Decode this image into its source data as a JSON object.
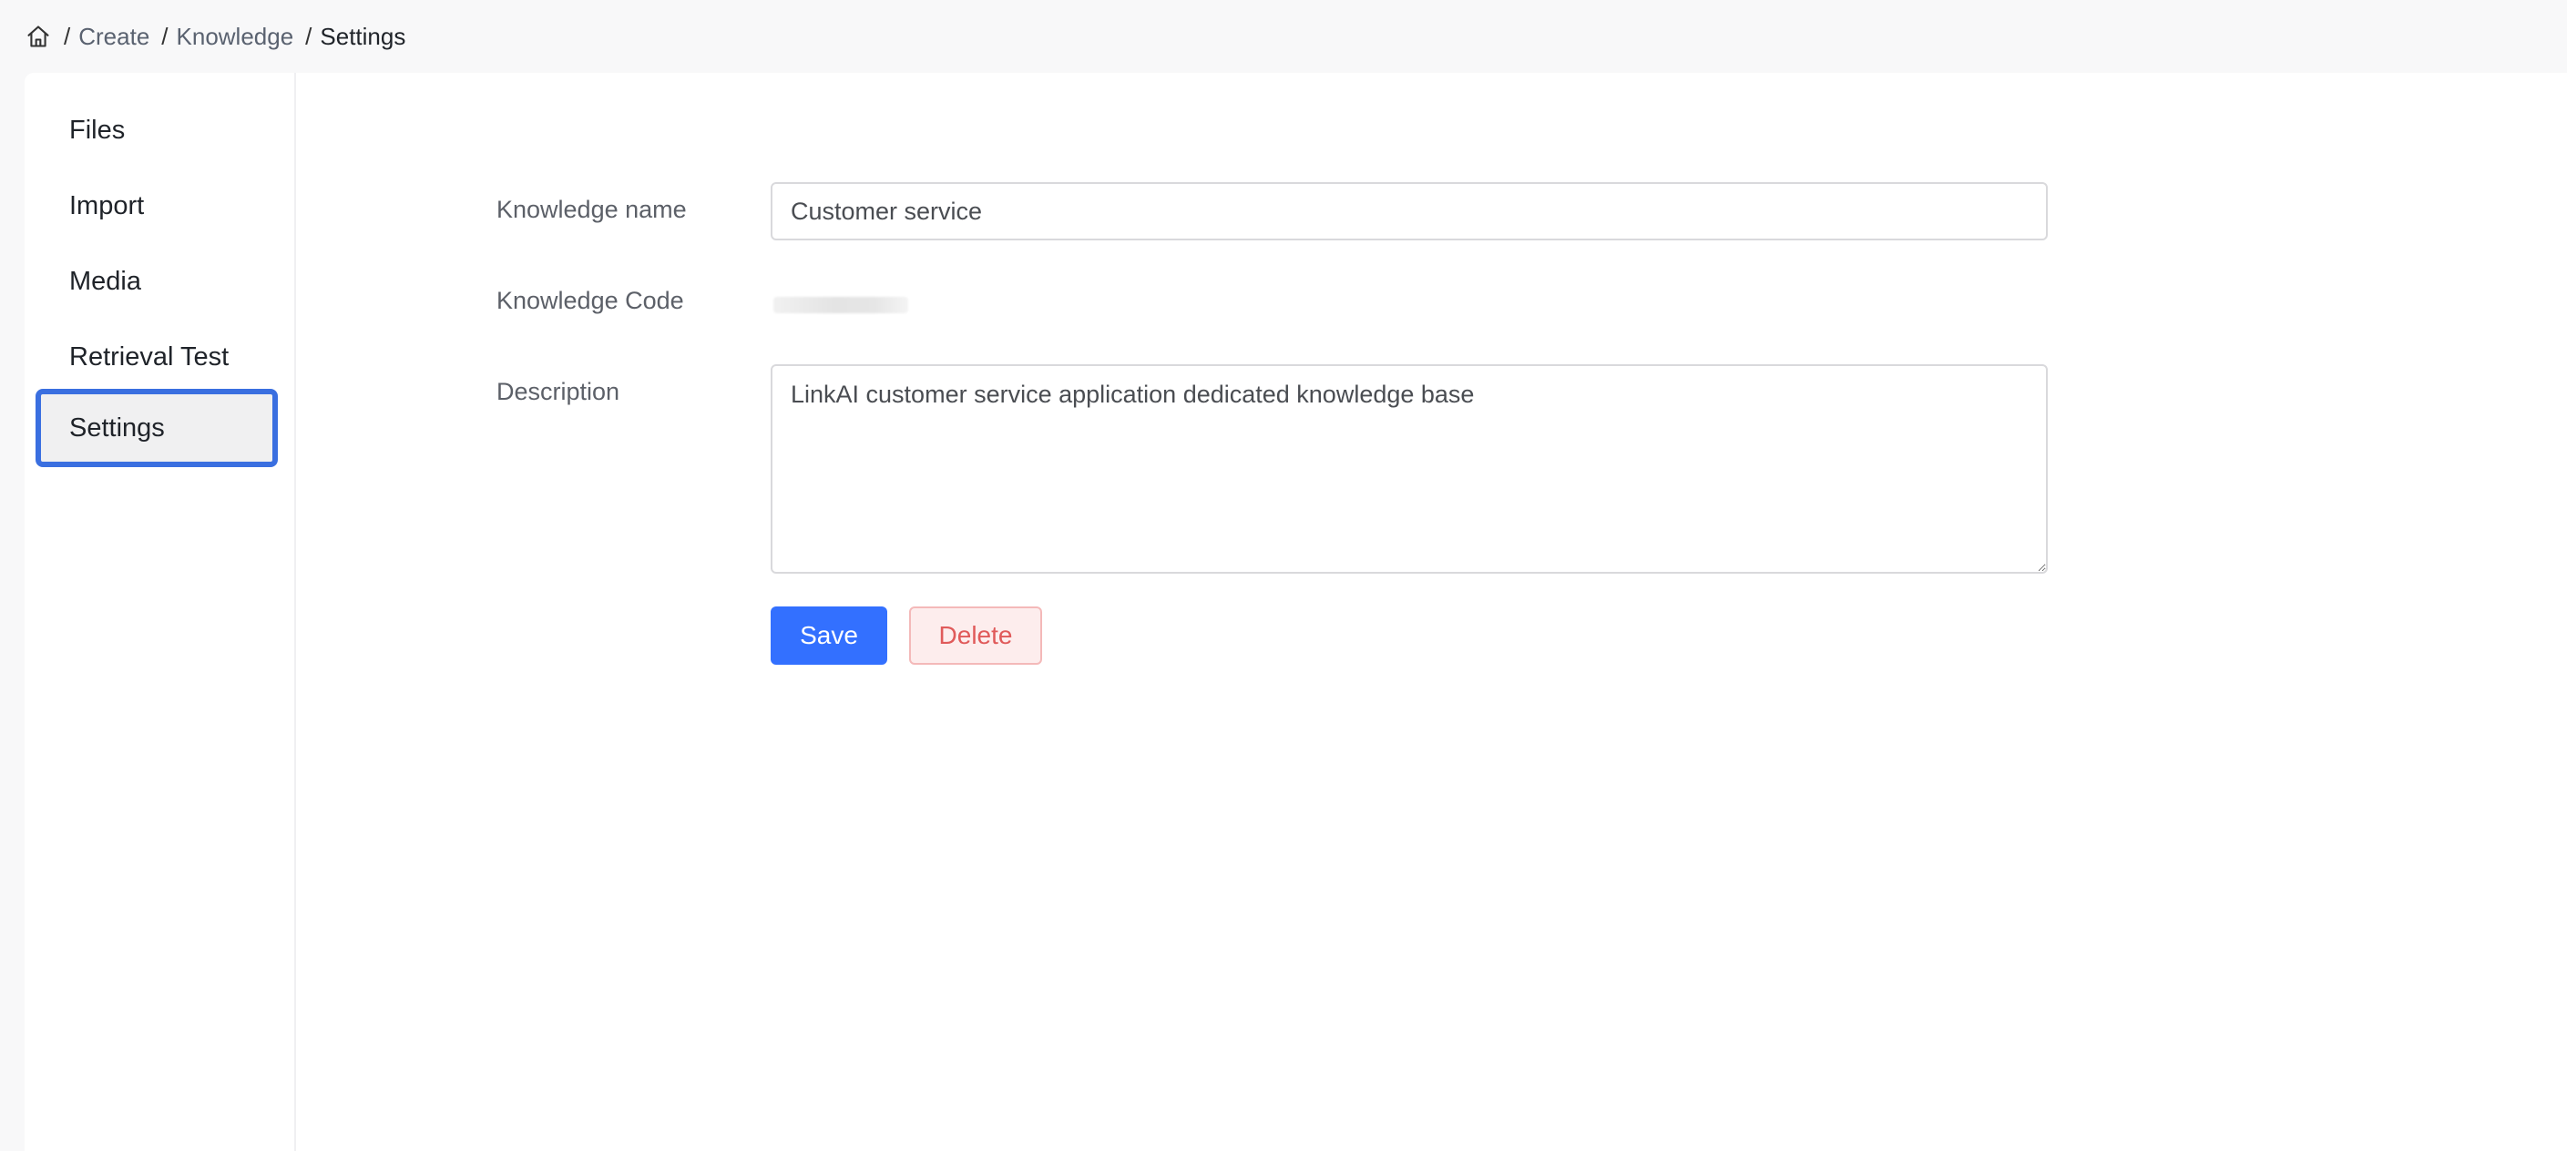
{
  "breadcrumb": {
    "separator": "/",
    "items": [
      {
        "label": "Create"
      },
      {
        "label": "Knowledge"
      },
      {
        "label": "Settings"
      }
    ]
  },
  "sidebar": {
    "items": [
      {
        "label": "Files"
      },
      {
        "label": "Import"
      },
      {
        "label": "Media"
      },
      {
        "label": "Retrieval Test"
      },
      {
        "label": "Settings",
        "active": true
      }
    ]
  },
  "form": {
    "name_label": "Knowledge name",
    "name_value": "Customer service",
    "code_label": "Knowledge Code",
    "description_label": "Description",
    "description_value": "LinkAI customer service application dedicated knowledge base",
    "save_label": "Save",
    "delete_label": "Delete"
  },
  "colors": {
    "accent": "#3370ff",
    "active_outline": "#3a6fe0",
    "danger": "#e05a5a"
  },
  "icons": {
    "home": "home-icon"
  }
}
